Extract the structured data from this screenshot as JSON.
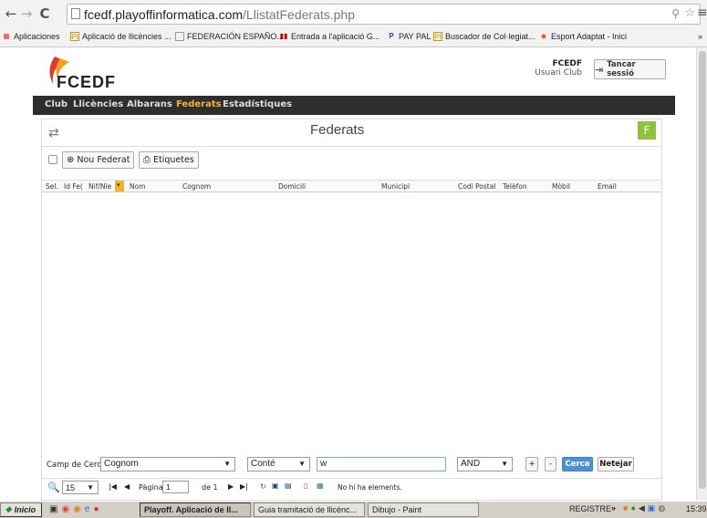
{
  "browser": {
    "url_domain": "fcedf.playoffinformatica.com",
    "url_path": "/LlistatFederats.php",
    "bookmarks": [
      {
        "label": "Aplicaciones",
        "icon": "apps-grid-icon"
      },
      {
        "label": "Aplicació de llicències ...",
        "icon": "pi-favicon"
      },
      {
        "label": "FEDERACIÓN ESPAÑO...",
        "icon": "page-icon"
      },
      {
        "label": "Entrada a l'aplicació G...",
        "icon": "red-bars-favicon"
      },
      {
        "label": "PAY PAL",
        "icon": "paypal-icon"
      },
      {
        "label": "Buscador de Col·legiat...",
        "icon": "pi-favicon"
      },
      {
        "label": "Esport Adaptat - Inici",
        "icon": "esport-favicon"
      }
    ],
    "more": "»"
  },
  "header": {
    "logo_text": "FCEDF",
    "user_name": "FCEDF",
    "user_role": "Usuari Club",
    "logout_label": "Tancar sessió"
  },
  "menu": {
    "items": [
      {
        "label": "Club"
      },
      {
        "label": "Llicències"
      },
      {
        "label": "Albarans"
      },
      {
        "label": "Federats"
      },
      {
        "label": "Estadístiques"
      }
    ],
    "active": "Federats"
  },
  "panel": {
    "title": "Federats",
    "badge": "F",
    "new_button": "Nou Federat",
    "labels_button": "Etiquetes"
  },
  "grid": {
    "columns": [
      "Sel.",
      "Id Fe(",
      "Nif/Nie",
      "Nom",
      "Cognom",
      "Domicili",
      "Municipi",
      "Codi Postal",
      "Telèfon",
      "Mòbil",
      "Email"
    ]
  },
  "search": {
    "field_label": "Camp de Cerca",
    "field_value": "Cognom",
    "operator_value": "Conté",
    "query_value": "w",
    "logic_value": "AND",
    "plus_label": "+",
    "minus_label": "-",
    "search_button": "Cerca",
    "clear_button": "Netejar"
  },
  "pager": {
    "page_size": "15",
    "page_label": "Pàgina",
    "page_value": "1",
    "of_label": "de 1",
    "status": "No hi ha elements."
  },
  "taskbar": {
    "start_label": "Inicio",
    "tasks": [
      {
        "label": "Playoff. Aplicació de ll...",
        "active": true
      },
      {
        "label": "Guia tramitació de llicènc...",
        "active": false
      },
      {
        "label": "Dibujo - Paint",
        "active": false
      }
    ],
    "tray_label": "REGISTRE",
    "tray_more": "»",
    "clock": "15:39"
  },
  "colors": {
    "menu_bg": "#2e2e2e",
    "accent": "#f0b530",
    "badge": "#8fc43a",
    "search_button": "#4f8fd6"
  }
}
